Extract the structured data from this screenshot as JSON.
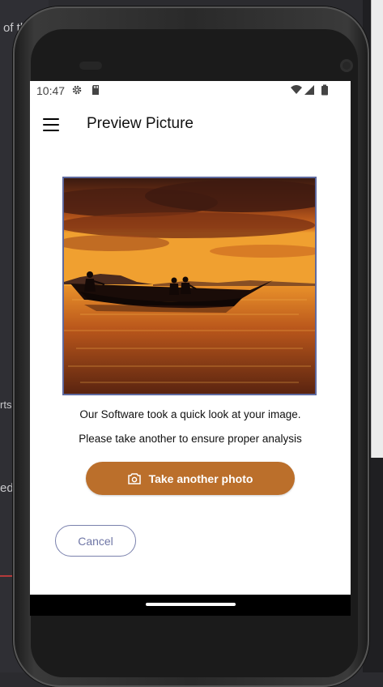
{
  "background": {
    "snippet_top": "of th",
    "snippet_mid": "rts",
    "snippet_low": "ed"
  },
  "statusbar": {
    "time": "10:47",
    "icons": [
      "settings-gear-icon",
      "sd-card-icon",
      "wifi-icon",
      "signal-icon",
      "battery-icon"
    ]
  },
  "appbar": {
    "title": "Preview Picture",
    "menu_icon": "hamburger-menu-icon"
  },
  "content": {
    "image_desc": "sunset-boat-photo",
    "message_line1": "Our Software took a quick look at your image.",
    "message_line2": "Please take another to ensure proper analysis",
    "primary_button": "Take another photo",
    "primary_button_icon": "camera-icon",
    "secondary_button": "Cancel"
  },
  "colors": {
    "primary": "#bb6f2b",
    "outline": "#7a81ad",
    "photo_border": "#5e6aa0"
  }
}
